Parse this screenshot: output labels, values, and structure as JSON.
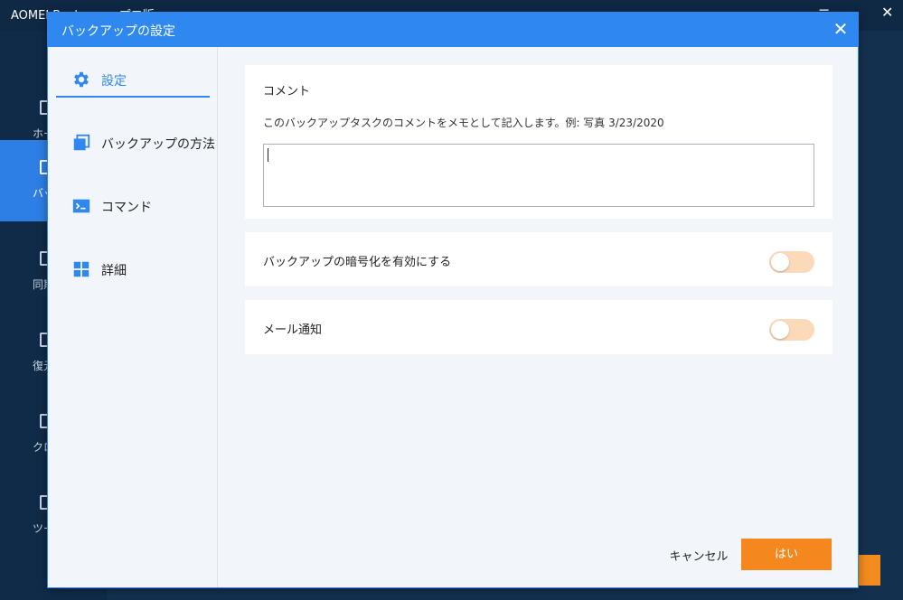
{
  "background_app": {
    "title": "AOMEI Backupper プロ版",
    "window_controls": {
      "min": "—",
      "menu": "≡",
      "close": "✕"
    },
    "nav": [
      {
        "label": "ホーム"
      },
      {
        "label": "バックアップ"
      },
      {
        "label": "同期"
      },
      {
        "label": "復元"
      },
      {
        "label": "クローン"
      },
      {
        "label": "ツール"
      }
    ]
  },
  "dialog": {
    "title": "バックアップの設定",
    "close_glyph": "✕",
    "sidebar": [
      {
        "label": "設定",
        "icon": "gear-icon"
      },
      {
        "label": "バックアップの方法",
        "icon": "copy-icon"
      },
      {
        "label": "コマンド",
        "icon": "terminal-icon"
      },
      {
        "label": "詳細",
        "icon": "grid-icon"
      }
    ],
    "comment": {
      "title": "コメント",
      "description": "このバックアップタスクのコメントをメモとして記入します。例: 写真 3/23/2020",
      "value": ""
    },
    "encryption": {
      "label": "バックアップの暗号化を有効にする"
    },
    "email": {
      "label": "メール通知"
    },
    "buttons": {
      "cancel": "キャンセル",
      "ok": "はい"
    }
  },
  "colors": {
    "accent": "#2f88ef",
    "orange": "#f5871f",
    "toggle_off": "#fcd9b8"
  }
}
